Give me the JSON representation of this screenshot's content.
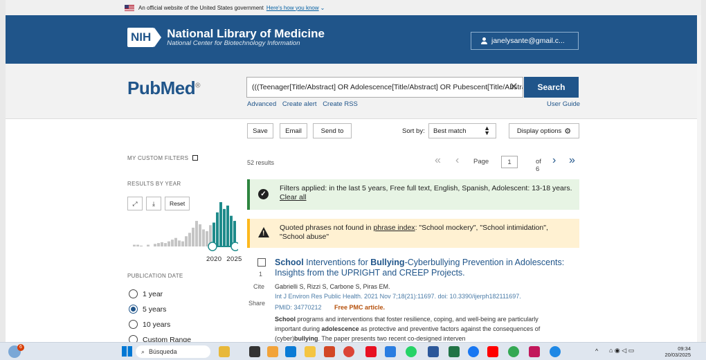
{
  "gov_banner": {
    "text": "An official website of the United States government",
    "link": "Here's how you know"
  },
  "header": {
    "nih_abbrev": "NIH",
    "title": "National Library of Medicine",
    "subtitle": "National Center for Biotechnology Information",
    "account": "janelysante@gmail.c..."
  },
  "search": {
    "logo_pub": "Pub",
    "logo_med": "Med",
    "logo_reg": "®",
    "query": "(((Teenager[Title/Abstract] OR Adolescence[Title/Abstract] OR Pubescent[Title/Abstract]",
    "button": "Search",
    "links": [
      "Advanced",
      "Create alert",
      "Create RSS"
    ],
    "user_guide": "User Guide"
  },
  "actions": {
    "save": "Save",
    "email": "Email",
    "send_to": "Send to",
    "sort_label": "Sort by:",
    "sort_value": "Best match",
    "display_options": "Display options"
  },
  "sidebar": {
    "custom_filters": "MY CUSTOM FILTERS",
    "results_by_year": "RESULTS BY YEAR",
    "reset": "Reset",
    "year_start": "2020",
    "year_end": "2025",
    "publication_date": "PUBLICATION DATE",
    "date_options": [
      {
        "label": "1 year",
        "checked": false
      },
      {
        "label": "5 years",
        "checked": true
      },
      {
        "label": "10 years",
        "checked": false
      },
      {
        "label": "Custom Range",
        "checked": false
      }
    ]
  },
  "results": {
    "count": "52 results",
    "page_label": "Page",
    "page_value": "1",
    "page_total": "of 6"
  },
  "alerts": {
    "filters_text": "Filters applied: in the last 5 years, Free full text, English, Spanish, Adolescent: 13-18 years.",
    "clear_all": "Clear all",
    "warn_prefix": "Quoted phrases not found in",
    "warn_link": "phrase index",
    "warn_suffix": ": \"School mockery\", \"School intimidation\", \"School abuse\""
  },
  "result_item": {
    "number": "1",
    "cite": "Cite",
    "share": "Share",
    "title_parts": [
      "School",
      " Interventions for ",
      "Bullying",
      "-Cyberbullying Prevention in Adolescents: Insights from the UPRIGHT and CREEP Projects."
    ],
    "authors": "Gabrielli S, Rizzi S, Carbone S, Piras EM.",
    "citation": "Int J Environ Res Public Health. 2021 Nov 7;18(21):11697. doi: 10.3390/ijerph182111697.",
    "pmid": "PMID: 34770212",
    "free": "Free PMC article.",
    "snippet_b1": "School",
    "snippet_1": " programs and interventions that foster resilience, coping, and well-being are particularly important during ",
    "snippet_b2": "adolescence",
    "snippet_2": " as protective and preventive factors against the consequences of (cyber)",
    "snippet_b3": "bullying",
    "snippet_3": ". The paper presents two recent co-designed interven"
  },
  "histogram": {
    "values": [
      2,
      2,
      1,
      0,
      2,
      0,
      3,
      4,
      5,
      4,
      6,
      8,
      10,
      7,
      6,
      12,
      16,
      22,
      30,
      26,
      20,
      18,
      25,
      28,
      40,
      52,
      44,
      48,
      36,
      30
    ],
    "colors": {
      "old": "#c5c5c5",
      "selected": "#1f8b8b"
    }
  },
  "taskbar": {
    "search": "Búsqueda",
    "time": "09:34",
    "date": "20/03/2025",
    "badge": "6"
  }
}
